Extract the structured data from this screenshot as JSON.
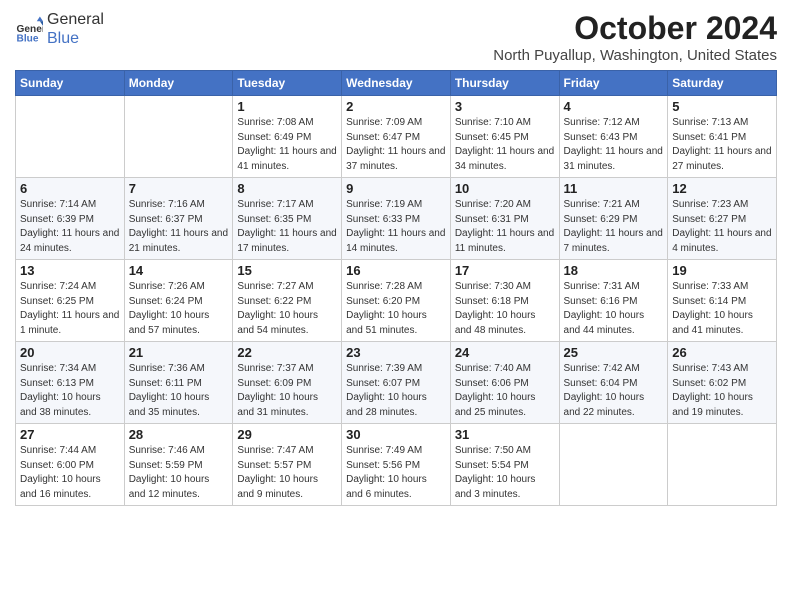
{
  "header": {
    "logo_line1": "General",
    "logo_line2": "Blue",
    "month": "October 2024",
    "location": "North Puyallup, Washington, United States"
  },
  "days_of_week": [
    "Sunday",
    "Monday",
    "Tuesday",
    "Wednesday",
    "Thursday",
    "Friday",
    "Saturday"
  ],
  "weeks": [
    [
      {
        "day": "",
        "info": ""
      },
      {
        "day": "",
        "info": ""
      },
      {
        "day": "1",
        "info": "Sunrise: 7:08 AM\nSunset: 6:49 PM\nDaylight: 11 hours and 41 minutes."
      },
      {
        "day": "2",
        "info": "Sunrise: 7:09 AM\nSunset: 6:47 PM\nDaylight: 11 hours and 37 minutes."
      },
      {
        "day": "3",
        "info": "Sunrise: 7:10 AM\nSunset: 6:45 PM\nDaylight: 11 hours and 34 minutes."
      },
      {
        "day": "4",
        "info": "Sunrise: 7:12 AM\nSunset: 6:43 PM\nDaylight: 11 hours and 31 minutes."
      },
      {
        "day": "5",
        "info": "Sunrise: 7:13 AM\nSunset: 6:41 PM\nDaylight: 11 hours and 27 minutes."
      }
    ],
    [
      {
        "day": "6",
        "info": "Sunrise: 7:14 AM\nSunset: 6:39 PM\nDaylight: 11 hours and 24 minutes."
      },
      {
        "day": "7",
        "info": "Sunrise: 7:16 AM\nSunset: 6:37 PM\nDaylight: 11 hours and 21 minutes."
      },
      {
        "day": "8",
        "info": "Sunrise: 7:17 AM\nSunset: 6:35 PM\nDaylight: 11 hours and 17 minutes."
      },
      {
        "day": "9",
        "info": "Sunrise: 7:19 AM\nSunset: 6:33 PM\nDaylight: 11 hours and 14 minutes."
      },
      {
        "day": "10",
        "info": "Sunrise: 7:20 AM\nSunset: 6:31 PM\nDaylight: 11 hours and 11 minutes."
      },
      {
        "day": "11",
        "info": "Sunrise: 7:21 AM\nSunset: 6:29 PM\nDaylight: 11 hours and 7 minutes."
      },
      {
        "day": "12",
        "info": "Sunrise: 7:23 AM\nSunset: 6:27 PM\nDaylight: 11 hours and 4 minutes."
      }
    ],
    [
      {
        "day": "13",
        "info": "Sunrise: 7:24 AM\nSunset: 6:25 PM\nDaylight: 11 hours and 1 minute."
      },
      {
        "day": "14",
        "info": "Sunrise: 7:26 AM\nSunset: 6:24 PM\nDaylight: 10 hours and 57 minutes."
      },
      {
        "day": "15",
        "info": "Sunrise: 7:27 AM\nSunset: 6:22 PM\nDaylight: 10 hours and 54 minutes."
      },
      {
        "day": "16",
        "info": "Sunrise: 7:28 AM\nSunset: 6:20 PM\nDaylight: 10 hours and 51 minutes."
      },
      {
        "day": "17",
        "info": "Sunrise: 7:30 AM\nSunset: 6:18 PM\nDaylight: 10 hours and 48 minutes."
      },
      {
        "day": "18",
        "info": "Sunrise: 7:31 AM\nSunset: 6:16 PM\nDaylight: 10 hours and 44 minutes."
      },
      {
        "day": "19",
        "info": "Sunrise: 7:33 AM\nSunset: 6:14 PM\nDaylight: 10 hours and 41 minutes."
      }
    ],
    [
      {
        "day": "20",
        "info": "Sunrise: 7:34 AM\nSunset: 6:13 PM\nDaylight: 10 hours and 38 minutes."
      },
      {
        "day": "21",
        "info": "Sunrise: 7:36 AM\nSunset: 6:11 PM\nDaylight: 10 hours and 35 minutes."
      },
      {
        "day": "22",
        "info": "Sunrise: 7:37 AM\nSunset: 6:09 PM\nDaylight: 10 hours and 31 minutes."
      },
      {
        "day": "23",
        "info": "Sunrise: 7:39 AM\nSunset: 6:07 PM\nDaylight: 10 hours and 28 minutes."
      },
      {
        "day": "24",
        "info": "Sunrise: 7:40 AM\nSunset: 6:06 PM\nDaylight: 10 hours and 25 minutes."
      },
      {
        "day": "25",
        "info": "Sunrise: 7:42 AM\nSunset: 6:04 PM\nDaylight: 10 hours and 22 minutes."
      },
      {
        "day": "26",
        "info": "Sunrise: 7:43 AM\nSunset: 6:02 PM\nDaylight: 10 hours and 19 minutes."
      }
    ],
    [
      {
        "day": "27",
        "info": "Sunrise: 7:44 AM\nSunset: 6:00 PM\nDaylight: 10 hours and 16 minutes."
      },
      {
        "day": "28",
        "info": "Sunrise: 7:46 AM\nSunset: 5:59 PM\nDaylight: 10 hours and 12 minutes."
      },
      {
        "day": "29",
        "info": "Sunrise: 7:47 AM\nSunset: 5:57 PM\nDaylight: 10 hours and 9 minutes."
      },
      {
        "day": "30",
        "info": "Sunrise: 7:49 AM\nSunset: 5:56 PM\nDaylight: 10 hours and 6 minutes."
      },
      {
        "day": "31",
        "info": "Sunrise: 7:50 AM\nSunset: 5:54 PM\nDaylight: 10 hours and 3 minutes."
      },
      {
        "day": "",
        "info": ""
      },
      {
        "day": "",
        "info": ""
      }
    ]
  ]
}
